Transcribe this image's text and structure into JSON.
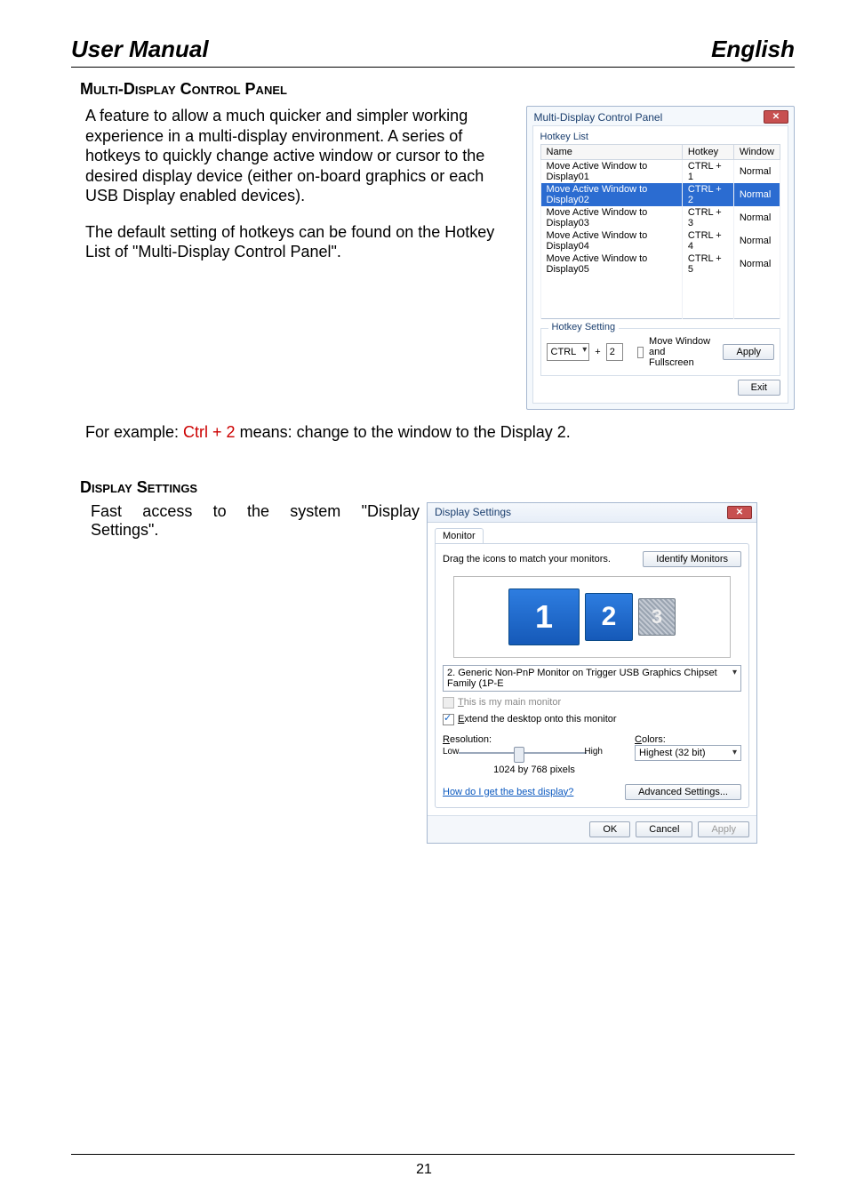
{
  "header": {
    "left": "User Manual",
    "right": "English"
  },
  "section1": {
    "title": "Multi-Display Control Panel",
    "para1": "A feature to allow a much quicker and simpler working experience in a multi-display environment.  A series of hotkeys  to quickly change active window or cursor to the desired display device (either on-board graphics or each USB Display enabled devices).",
    "para2": "The default setting of hotkeys can be found on the Hotkey List of \"Multi-Display Control Panel\".",
    "example_prefix": "For example: ",
    "example_hotkey": "Ctrl + 2",
    "example_suffix": " means: change to the window to the Display 2."
  },
  "mdcp": {
    "title": "Multi-Display Control Panel",
    "group_list": "Hotkey List",
    "columns": [
      "Name",
      "Hotkey",
      "Window"
    ],
    "rows": [
      {
        "name": "Move Active Window to Display01",
        "hotkey": "CTRL + 1",
        "window": "Normal",
        "selected": false
      },
      {
        "name": "Move Active Window to Display02",
        "hotkey": "CTRL + 2",
        "window": "Normal",
        "selected": true
      },
      {
        "name": "Move Active Window to Display03",
        "hotkey": "CTRL + 3",
        "window": "Normal",
        "selected": false
      },
      {
        "name": "Move Active Window to Display04",
        "hotkey": "CTRL + 4",
        "window": "Normal",
        "selected": false
      },
      {
        "name": "Move Active Window to Display05",
        "hotkey": "CTRL + 5",
        "window": "Normal",
        "selected": false
      }
    ],
    "group_setting": "Hotkey Setting",
    "modifier": "CTRL",
    "plus": "+",
    "keyval": "2",
    "fullscreen_label": "Move Window and Fullscreen",
    "apply": "Apply",
    "exit": "Exit"
  },
  "section2": {
    "title": "Display Settings",
    "line1": "Fast access to the system \"Display",
    "line2": "Settings\"."
  },
  "ds": {
    "title": "Display Settings",
    "tab": "Monitor",
    "drag_text": "Drag the icons to match your monitors.",
    "identify": "Identify Monitors",
    "monitors": {
      "m1": "1",
      "m2": "2",
      "m3": "3"
    },
    "combo_text": "2. Generic Non-PnP Monitor on Trigger USB Graphics Chipset Family (1P-E",
    "chk_main": "This is my main monitor",
    "chk_extend": "Extend the desktop onto this monitor",
    "label_res": "Resolution:",
    "slider_low": "Low",
    "slider_high": "High",
    "res_value": "1024 by 768 pixels",
    "label_colors": "Colors:",
    "colors_value": "Highest (32 bit)",
    "help_link": "How do I get the best display?",
    "advanced": "Advanced Settings...",
    "ok": "OK",
    "cancel": "Cancel",
    "apply": "Apply"
  },
  "page_number": "21"
}
